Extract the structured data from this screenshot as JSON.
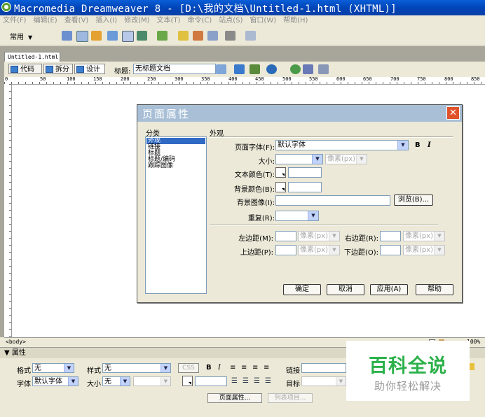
{
  "window": {
    "title": "Macromedia Dreamweaver 8 - [D:\\我的文档\\Untitled-1.html (XHTML)]"
  },
  "menu": [
    "文件(F)",
    "编辑(E)",
    "查看(V)",
    "插入(I)",
    "修改(M)",
    "文本(T)",
    "命令(C)",
    "站点(S)",
    "窗口(W)",
    "帮助(H)"
  ],
  "insert_bar": {
    "category": "常用"
  },
  "document": {
    "tab": "Untitled-1.html",
    "view_code": "代码",
    "view_split": "拆分",
    "view_design": "设计",
    "title_label": "标题:",
    "title_value": "无标题文档"
  },
  "ruler_labels": [
    "0",
    "50",
    "100",
    "150",
    "200",
    "250",
    "300",
    "350",
    "400",
    "450",
    "500",
    "550",
    "600",
    "650",
    "700",
    "750",
    "800",
    "850"
  ],
  "status": {
    "tag": "<body>",
    "zoom": "100%"
  },
  "properties": {
    "header": "▼ 属性",
    "format_label": "格式",
    "format_value": "无",
    "style_label": "样式",
    "style_value": "无",
    "css_label": "CSS",
    "bold": "B",
    "italic": "I",
    "link_label": "链接",
    "font_label": "字体",
    "font_value": "默认字体",
    "size_label": "大小",
    "size_value": "无",
    "target_label": "目标",
    "page_props_button": "页面属性...",
    "list_item_button": "列表项目..."
  },
  "dialog": {
    "title": "页面属性",
    "category_header": "分类",
    "section_header": "外观",
    "categories": [
      "外观",
      "链接",
      "标题",
      "标题/编码",
      "跟踪图像"
    ],
    "selected_category": 0,
    "page_font_label": "页面字体(F):",
    "page_font_value": "默认字体",
    "bold": "B",
    "italic": "I",
    "size_label": "大小:",
    "size_unit": "像素(px)",
    "text_color_label": "文本颜色(T):",
    "bg_color_label": "背景颜色(B):",
    "bg_image_label": "背景图像(I):",
    "browse_button": "浏览(B)...",
    "repeat_label": "重复(R):",
    "left_margin_label": "左边距(M):",
    "right_margin_label": "右边距(R):",
    "top_margin_label": "上边距(P):",
    "bottom_margin_label": "下边距(O):",
    "margin_unit": "像素(px)",
    "ok_button": "确定",
    "cancel_button": "取消",
    "apply_button": "应用(A)",
    "help_button": "帮助"
  },
  "watermark": {
    "line1": "百科全说",
    "line2": "助你轻松解决"
  },
  "colors": {
    "titlebar": "#0a5ed8",
    "dialog_title": "#a8bfd6",
    "close": "#e0522a",
    "selection": "#316ac5",
    "watermark": "#2cb14a"
  }
}
